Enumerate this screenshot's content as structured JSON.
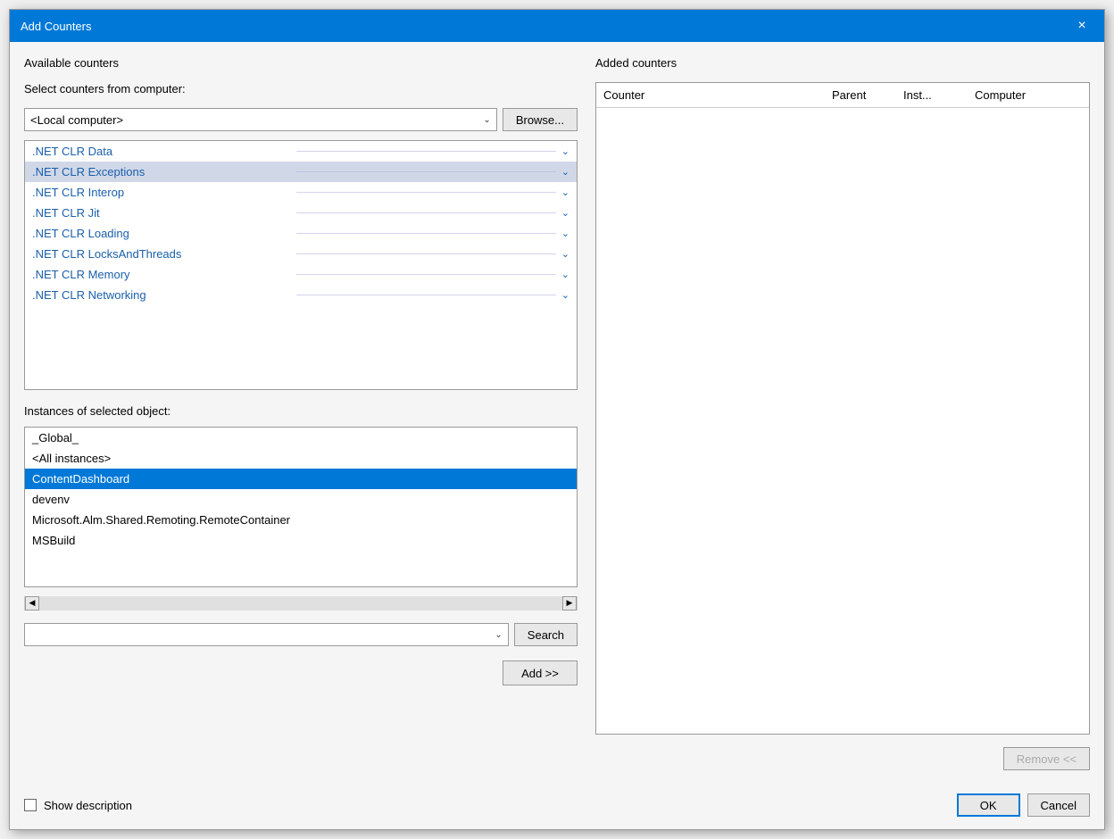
{
  "dialog": {
    "title": "Add Counters",
    "close_label": "×"
  },
  "left": {
    "available_counters_label": "Available counters",
    "select_from_label": "Select counters from computer:",
    "computer_value": "<Local computer>",
    "browse_label": "Browse...",
    "counters": [
      {
        "name": ".NET CLR Data",
        "selected": false
      },
      {
        "name": ".NET CLR Exceptions",
        "selected": true
      },
      {
        "name": ".NET CLR Interop",
        "selected": false
      },
      {
        "name": ".NET CLR Jit",
        "selected": false
      },
      {
        "name": ".NET CLR Loading",
        "selected": false
      },
      {
        "name": ".NET CLR LocksAndThreads",
        "selected": false
      },
      {
        "name": ".NET CLR Memory",
        "selected": false
      },
      {
        "name": ".NET CLR Networking",
        "selected": false
      }
    ],
    "instances_label": "Instances of selected object:",
    "instances": [
      {
        "name": "_Global_",
        "selected": false
      },
      {
        "name": "<All instances>",
        "selected": false
      },
      {
        "name": "ContentDashboard",
        "selected": true
      },
      {
        "name": "devenv",
        "selected": false
      },
      {
        "name": "Microsoft.Alm.Shared.Remoting.RemoteContainer",
        "selected": false
      },
      {
        "name": "MSBuild",
        "selected": false
      }
    ],
    "search_placeholder": "",
    "search_label": "Search",
    "add_label": "Add >>"
  },
  "right": {
    "added_counters_label": "Added counters",
    "columns": [
      "Counter",
      "Parent",
      "Inst...",
      "Computer"
    ],
    "remove_label": "Remove <<"
  },
  "footer": {
    "show_description_label": "Show description",
    "ok_label": "OK",
    "cancel_label": "Cancel"
  }
}
